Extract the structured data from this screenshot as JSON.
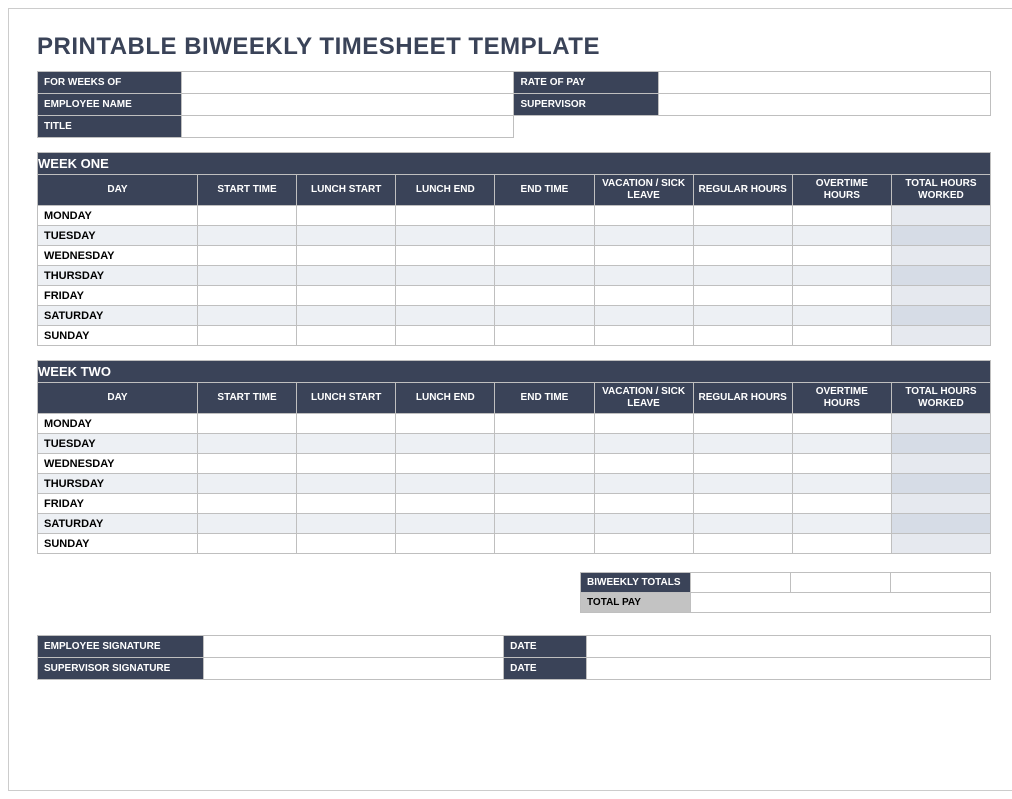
{
  "title": "PRINTABLE BIWEEKLY TIMESHEET TEMPLATE",
  "info": {
    "for_weeks_of_label": "FOR WEEKS OF",
    "for_weeks_of_value": "",
    "rate_of_pay_label": "RATE OF PAY",
    "rate_of_pay_value": "",
    "employee_name_label": "EMPLOYEE NAME",
    "employee_name_value": "",
    "supervisor_label": "SUPERVISOR",
    "supervisor_value": "",
    "title_label": "TITLE",
    "title_value": ""
  },
  "columns": {
    "day": "DAY",
    "start_time": "START TIME",
    "lunch_start": "LUNCH START",
    "lunch_end": "LUNCH END",
    "end_time": "END TIME",
    "vacation_sick": "VACATION / SICK LEAVE",
    "regular_hours": "REGULAR HOURS",
    "overtime_hours": "OVERTIME HOURS",
    "total_hours": "TOTAL HOURS WORKED"
  },
  "week_one": {
    "banner": "WEEK ONE",
    "days": [
      "MONDAY",
      "TUESDAY",
      "WEDNESDAY",
      "THURSDAY",
      "FRIDAY",
      "SATURDAY",
      "SUNDAY"
    ]
  },
  "week_two": {
    "banner": "WEEK TWO",
    "days": [
      "MONDAY",
      "TUESDAY",
      "WEDNESDAY",
      "THURSDAY",
      "FRIDAY",
      "SATURDAY",
      "SUNDAY"
    ]
  },
  "totals": {
    "biweekly_label": "BIWEEKLY TOTALS",
    "biweekly_regular": "",
    "biweekly_overtime": "",
    "biweekly_total": "",
    "total_pay_label": "TOTAL PAY",
    "total_pay_value": ""
  },
  "signatures": {
    "employee_label": "EMPLOYEE SIGNATURE",
    "employee_value": "",
    "supervisor_label": "SUPERVISOR SIGNATURE",
    "supervisor_value": "",
    "date_label": "DATE",
    "employee_date": "",
    "supervisor_date": ""
  }
}
